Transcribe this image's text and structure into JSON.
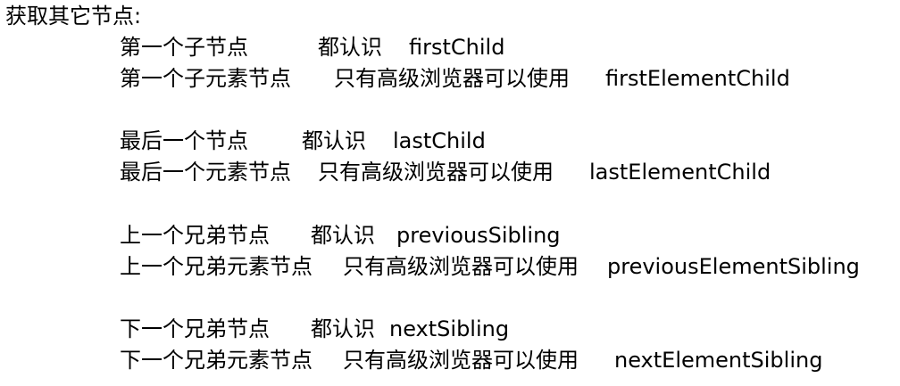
{
  "heading": "获取其它节点:",
  "groups": [
    {
      "rows": [
        {
          "label": "第一个子节点",
          "support": "都认识",
          "property": "firstChild"
        },
        {
          "label": "第一个子元素节点",
          "support": "只有高级浏览器可以使用",
          "property": "firstElementChild"
        }
      ]
    },
    {
      "rows": [
        {
          "label": "最后一个节点",
          "support": "都认识",
          "property": "lastChild"
        },
        {
          "label": "最后一个元素节点",
          "support": "只有高级浏览器可以使用",
          "property": "lastElementChild"
        }
      ]
    },
    {
      "rows": [
        {
          "label": "上一个兄弟节点",
          "support": "都认识",
          "property": "previousSibling"
        },
        {
          "label": "上一个兄弟元素节点",
          "support": "只有高级浏览器可以使用",
          "property": "previousElementSibling"
        }
      ]
    },
    {
      "rows": [
        {
          "label": "下一个兄弟节点",
          "support": "都认识",
          "property": "nextSibling"
        },
        {
          "label": "下一个兄弟元素节点",
          "support": "只有高级浏览器可以使用",
          "property": "nextElementSibling"
        }
      ]
    }
  ]
}
